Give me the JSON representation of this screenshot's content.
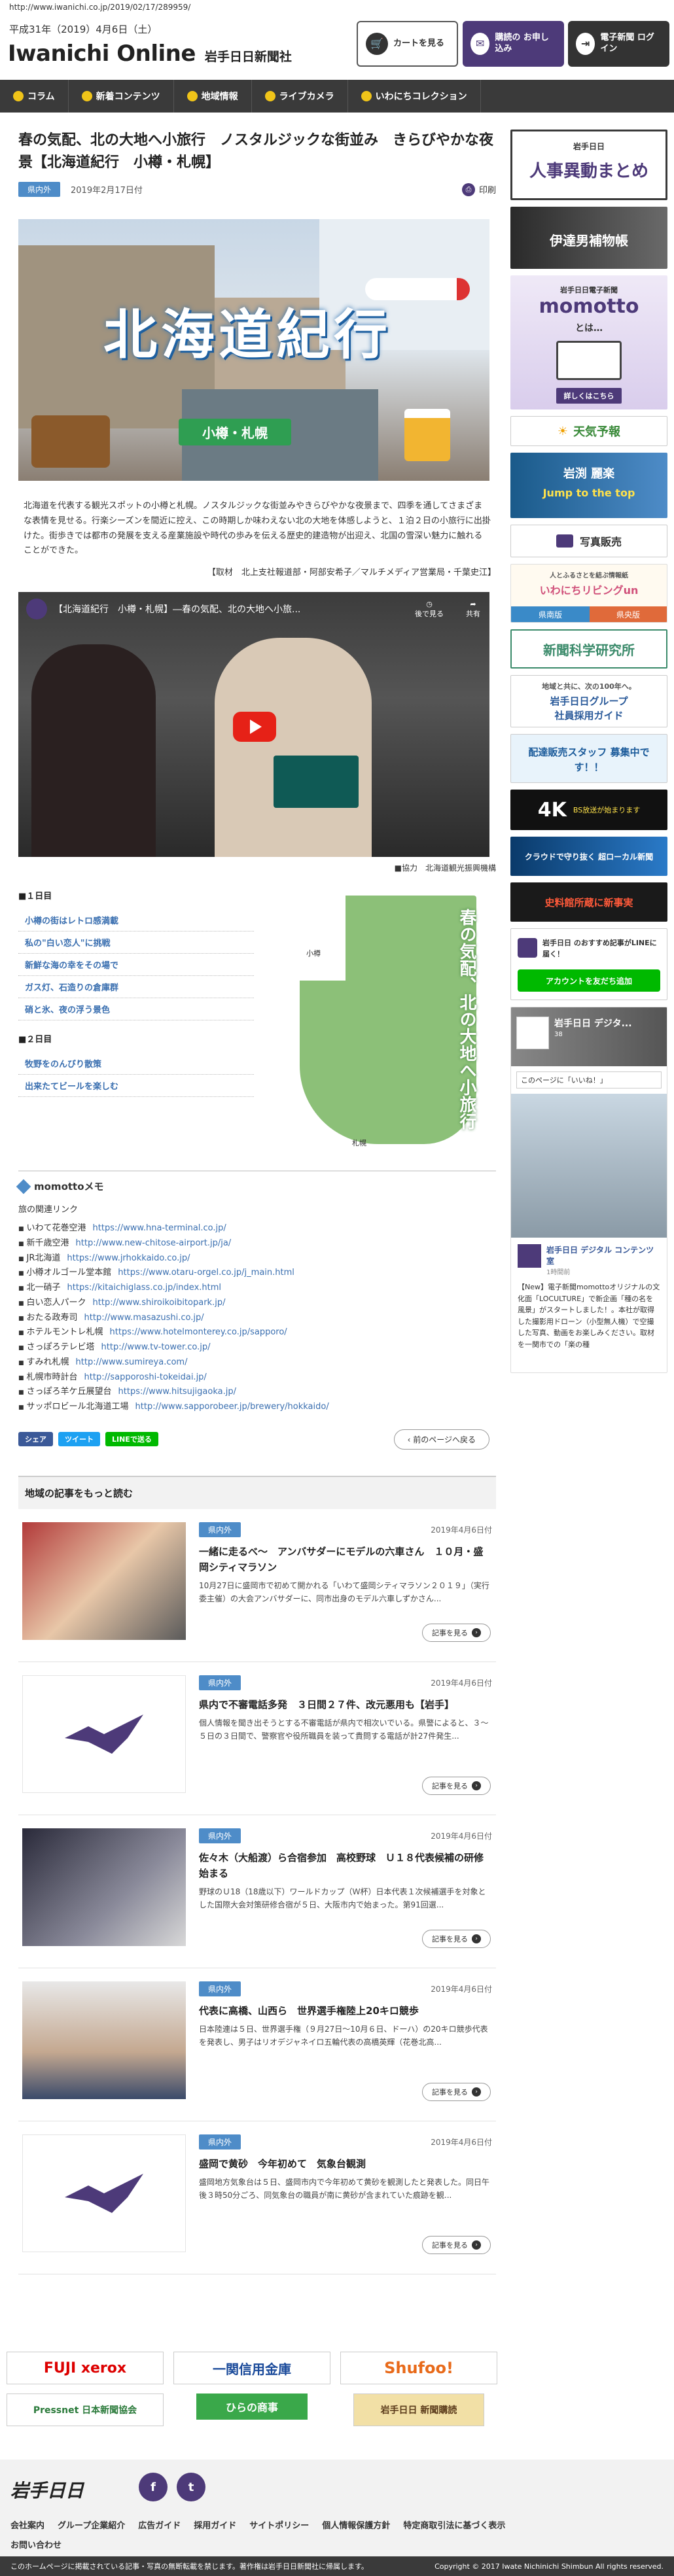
{
  "page": {
    "url": "http://www.iwanichi.co.jp/2019/02/17/289959/",
    "date_line": "平成31年（2019）4月6日（土）",
    "logo_main": "Iwanichi Online",
    "logo_sub": "岩手日日新聞社"
  },
  "header_buttons": {
    "cart": "カートを見る",
    "subscribe": "購読の お申し込み",
    "login": "電子新聞 ログイン"
  },
  "nav": {
    "items": [
      "コラム",
      "新着コンテンツ",
      "地域情報",
      "ライブカメラ",
      "いわにちコレクション"
    ]
  },
  "article": {
    "title": "春の気配、北の大地へ小旅行　ノスタルジックな街並み　きらびやかな夜景【北海道紀行　小樽・札幌】",
    "tag": "県内外",
    "date": "2019年2月17日付",
    "print": "印刷",
    "hero_title": "北海道紀行",
    "hero_badge": "小樽・札幌",
    "intro": "北海道を代表する観光スポットの小樽と札幌。ノスタルジックな街並みやきらびやかな夜景まで、四季を通してさまざまな表情を見せる。行楽シーズンを間近に控え、この時期しか味わえない北の大地を体感しようと、１泊２日の小旅行に出掛けた。街歩きでは都市の発展を支える産業施設や時代の歩みを伝える歴史的建造物が出迎え、北国の雪深い魅力に触れることができた。",
    "credit": "【取材　北上支社報道部・阿部安希子／マルチメディア営業局・千葉史江】",
    "video_title": "【北海道紀行　小樽・札幌】―春の気配、北の大地へ小旅...",
    "video_later": "後で見る",
    "video_share": "共有",
    "cooperation": "■協力　北海道観光振興機構",
    "day1_label": "■１日目",
    "day1_items": [
      "小樽の街はレトロ感満載",
      "私の\"白い恋人\"に挑戦",
      "新鮮な海の幸をその場で",
      "ガス灯、石造りの倉庫群",
      "硝と氷、夜の浮う景色"
    ],
    "day2_label": "■２日目",
    "day2_items": [
      "牧野をのんびり散策",
      "出来たてビールを楽しむ"
    ],
    "map_text": "春の気配、北の大地へ小旅行",
    "map_place1": "小樽",
    "map_place2": "札幌"
  },
  "memo": {
    "heading": "momottoメモ",
    "subheading": "旅の関連リンク",
    "links": [
      {
        "name": "いわて花巻空港",
        "url": "https://www.hna-terminal.co.jp/"
      },
      {
        "name": "新千歳空港",
        "url": "http://www.new-chitose-airport.jp/ja/"
      },
      {
        "name": "JR北海道",
        "url": "https://www.jrhokkaido.co.jp/"
      },
      {
        "name": "小樽オルゴール堂本館",
        "url": "https://www.otaru-orgel.co.jp/j_main.html"
      },
      {
        "name": "北一硝子",
        "url": "https://kitaichiglass.co.jp/index.html"
      },
      {
        "name": "白い恋人パーク",
        "url": "http://www.shiroikoibitopark.jp/"
      },
      {
        "name": "おたる政寿司",
        "url": "http://www.masazushi.co.jp/"
      },
      {
        "name": "ホテルモントレ札幌",
        "url": "https://www.hotelmonterey.co.jp/sapporo/"
      },
      {
        "name": "さっぽろテレビ塔",
        "url": "http://www.tv-tower.co.jp/"
      },
      {
        "name": "すみれ札幌",
        "url": "http://www.sumireya.com/"
      },
      {
        "name": "札幌市時計台",
        "url": "http://sapporoshi-tokeidai.jp/"
      },
      {
        "name": "さっぽろ羊ケ丘展望台",
        "url": "https://www.hitsujigaoka.jp/"
      },
      {
        "name": "サッポロビール北海道工場",
        "url": "http://www.sapporobeer.jp/brewery/hokkaido/"
      }
    ]
  },
  "share": {
    "facebook": "シェア",
    "twitter": "ツイート",
    "line": "LINEで送る",
    "back": "前のページへ戻る"
  },
  "related": {
    "heading": "地域の記事をもっと読む",
    "more_label": "記事を見る",
    "items": [
      {
        "tag": "県内外",
        "date": "2019年4月6日付",
        "title": "一緒に走るべ～　アンバサダーにモデルの六車さん　１０月・盛岡シティマラソン",
        "text": "10月27日に盛岡市で初めて開かれる「いわて盛岡シティマラソン２０１９」（実行委主催）の大会アンバサダーに、同市出身のモデル六車しずかさん..."
      },
      {
        "tag": "県内外",
        "date": "2019年4月6日付",
        "title": "県内で不審電話多発　３日間２７件、改元悪用も【岩手】",
        "text": "個人情報を聞き出そうとする不審電話が県内で相次いでいる。県警によると、３～５日の３日間で、警察官や役所職員を装って貴問する電話が計27件発生..."
      },
      {
        "tag": "県内外",
        "date": "2019年4月6日付",
        "title": "佐々木（大船渡）ら合宿参加　高校野球　Ｕ１８代表候補の研修始まる",
        "text": "野球のＵ18（18歳以下）ワールドカップ（Ｗ杯）日本代表１次候補選手を対象とした国際大会対策研修合宿が５日、大阪市内で始まった。第91回選..."
      },
      {
        "tag": "県内外",
        "date": "2019年4月6日付",
        "title": "代表に高橋、山西ら　世界選手権陸上20キロ競歩",
        "text": "日本陸連は５日、世界選手権（９月27日～10月６日、ドーハ）の20キロ競歩代表を発表し、男子はリオデジャネイロ五輪代表の高橋英輝（花巻北高..."
      },
      {
        "tag": "県内外",
        "date": "2019年4月6日付",
        "title": "盛岡で黄砂　今年初めて　気象台観測",
        "text": "盛岡地方気象台は５日、盛岡市内で今年初めて黄砂を観測したと発表した。同日午後３時50分ごろ、同気象台の職員が南に黄砂が含まれていた痕跡を観..."
      }
    ]
  },
  "sidebar": {
    "jinji": "人事異動まとめ",
    "jinji_sub": "岩手日日",
    "datebanner": "伊達男補物帳",
    "momotto_top": "岩手日日電子新聞",
    "momotto_title": "momotto",
    "momotto_q": "とは…",
    "momotto_btn": "詳しくはこちら",
    "weather": "天気予報",
    "iwami": "岩渕 麗楽",
    "iwami_sub": "Jump to the top",
    "photo": "写真販売",
    "living_top": "人とふるさとを結ぶ情報紙",
    "living": "いわにちリビングun",
    "living_l": "県南版",
    "living_r": "県央版",
    "lab": "新聞科学研究所",
    "group_top": "地域と共に、次の100年へ。",
    "group": "岩手日日グループ",
    "group_sub": "社員採用ガイド",
    "staff": "配達販売スタッフ 募集中です！！",
    "tv4k": "4K",
    "tv4k_sub": "BS放送が始まります",
    "cloud": "クラウドで守り抜く 超ローカル新聞",
    "history": "史料館所蔵に新事実",
    "line_text": "岩手日日 のおすすめ記事がLINEに届く！",
    "line_btn": "アカウントを友だち追加",
    "fb_name": "岩手日日 デジタ...",
    "fb_likes": "38",
    "fb_like_btn": "このページに「いいね！」",
    "fb_post_name": "岩手日日 デジタル コンテンツ室",
    "fb_post_text": "【New】電子新聞momottoオリジナルの文化面「LOCULTURE」で新企画「種の名を風景」がスタートしました！。本社が取得した撮影用ドローン（小型無人機）で空撮した写真、動画をお楽しみください。取材を一関市での「楽の種",
    "fb_hours": "1時間前"
  },
  "sponsors": {
    "fuji": "FUJI xerox",
    "ichinoseki": "一関信用金庫",
    "shufoo": "Shufoo!",
    "pressnet": "Pressnet 日本新聞協会",
    "hirano": "ひらの商事",
    "iwate": "岩手日日 新聞購読"
  },
  "footer": {
    "logo": "岩手日日",
    "links": [
      "会社案内",
      "グループ企業紹介",
      "広告ガイド",
      "採用ガイド",
      "サイトポリシー",
      "個人情報保護方針",
      "特定商取引法に基づく表示"
    ],
    "contact": "お問い合わせ",
    "notice": "このホームページに掲載されている記事・写真の無断転載を禁じます。著作権は岩手日日新聞社に帰属します。",
    "copyright": "Copyright © 2017 Iwate Nichinichi Shimbun All rights reserved."
  },
  "colors": {
    "accent": "#4d3a79",
    "tag": "#4e8cc8",
    "nav": "#3a3a3a"
  }
}
